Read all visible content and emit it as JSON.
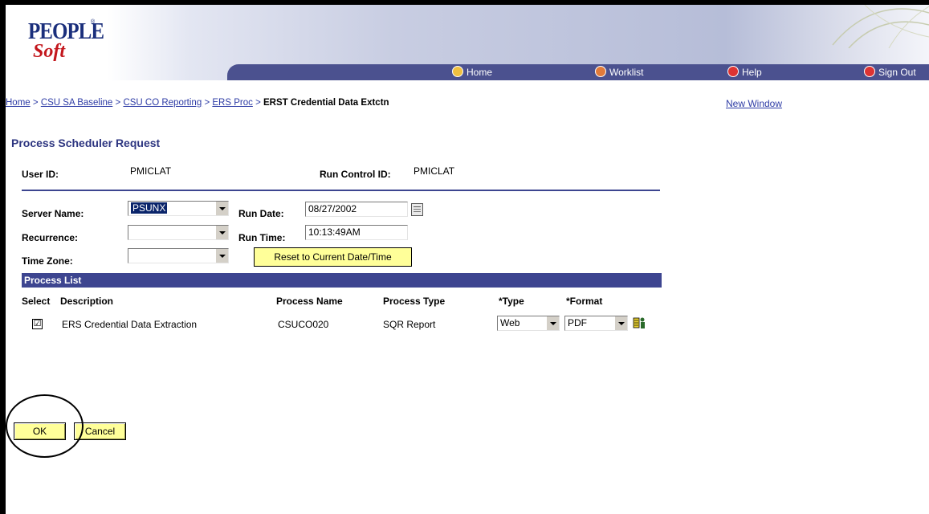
{
  "header": {
    "logo_line1": "PEOPLE",
    "logo_line2": "Soft",
    "logo_tm": "®",
    "nav": [
      {
        "label": "Home",
        "icon": "home-icon"
      },
      {
        "label": "Worklist",
        "icon": "worklist-icon"
      },
      {
        "label": "Help",
        "icon": "help-icon"
      },
      {
        "label": "Sign Out",
        "icon": "sign-out-icon"
      }
    ]
  },
  "breadcrumb": {
    "links": [
      "Home",
      "CSU SA Baseline",
      "CSU CO Reporting",
      "ERS Proc"
    ],
    "separator": ">",
    "current": "ERST Credential Data Extctn"
  },
  "new_window": "New Window",
  "page_title": "Process Scheduler Request",
  "user_id": {
    "label": "User ID:",
    "value": "PMICLAT"
  },
  "run_control": {
    "label": "Run Control ID:",
    "value": "PMICLAT"
  },
  "server_name": {
    "label": "Server Name:",
    "value": "PSUNX"
  },
  "recurrence": {
    "label": "Recurrence:",
    "value": ""
  },
  "time_zone": {
    "label": "Time Zone:",
    "value": ""
  },
  "run_date": {
    "label": "Run Date:",
    "value": "08/27/2002"
  },
  "run_time": {
    "label": "Run Time:",
    "value": "10:13:49AM"
  },
  "reset_button": "Reset to Current Date/Time",
  "process_list": {
    "title": "Process List",
    "headers": {
      "select": "Select",
      "description": "Description",
      "process_name": "Process Name",
      "process_type": "Process Type",
      "type": "*Type",
      "format": "*Format"
    },
    "rows": [
      {
        "checked": "☑",
        "description": "ERS Credential Data Extraction",
        "process_name": "CSUCO020",
        "process_type": "SQR Report",
        "type": "Web",
        "format": "PDF"
      }
    ]
  },
  "buttons": {
    "ok": "OK",
    "cancel": "Cancel"
  },
  "colors": {
    "nav_bar": "#4b518f",
    "list_bar": "#3d4590",
    "link": "#2d3ba5",
    "button_yellow": "#ffff99"
  }
}
